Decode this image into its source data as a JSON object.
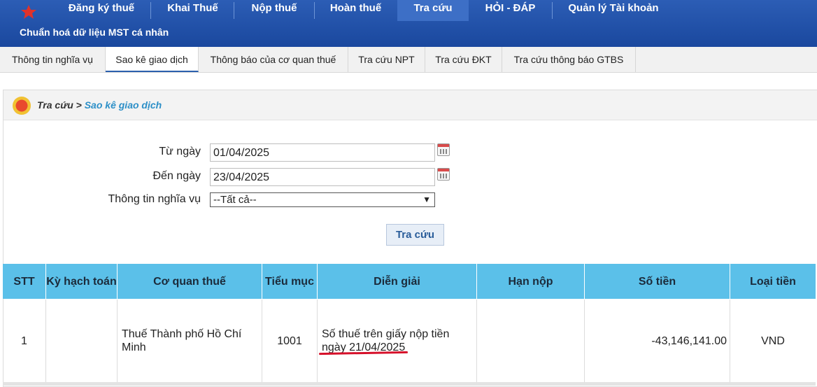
{
  "nav": {
    "items": [
      "Đăng ký thuế",
      "Khai Thuế",
      "Nộp thuế",
      "Hoàn thuế",
      "Tra cứu",
      "HỎI - ĐÁP",
      "Quản lý Tài khoản"
    ],
    "active": "Tra cứu",
    "subtitle": "Chuẩn hoá dữ liệu MST cá nhân"
  },
  "tabs": [
    "Thông tin nghĩa vụ",
    "Sao kê giao dịch",
    "Thông báo của cơ quan thuế",
    "Tra cứu NPT",
    "Tra cứu ĐKT",
    "Tra cứu thông báo GTBS"
  ],
  "active_tab": "Sao kê giao dịch",
  "breadcrumb": {
    "root": "Tra cứu >",
    "current": "Sao kê giao dịch"
  },
  "form": {
    "from_label": "Từ ngày",
    "from_value": "01/04/2025",
    "to_label": "Đến ngày",
    "to_value": "23/04/2025",
    "obligation_label": "Thông tin nghĩa vụ",
    "obligation_value": "--Tất cả--",
    "submit_label": "Tra cứu"
  },
  "table": {
    "headers": [
      "STT",
      "Kỳ hạch toán",
      "Cơ quan thuế",
      "Tiểu mục",
      "Diễn giải",
      "Hạn nộp",
      "Số tiền",
      "Loại tiền"
    ],
    "rows": [
      {
        "stt": "1",
        "ky_hach_toan": "",
        "co_quan_thue": "Thuế Thành phố Hồ Chí Minh",
        "tieu_muc": "1001",
        "dien_giai": "Số thuế trên giấy nộp tiền ngày 21/04/2025",
        "han_nop": "",
        "so_tien": "-43,146,141.00",
        "loai_tien": "VND"
      }
    ]
  },
  "colors": {
    "nav_bg": "#1a489e",
    "header_bg": "#5bc0e9",
    "annotation": "#d6102a"
  }
}
